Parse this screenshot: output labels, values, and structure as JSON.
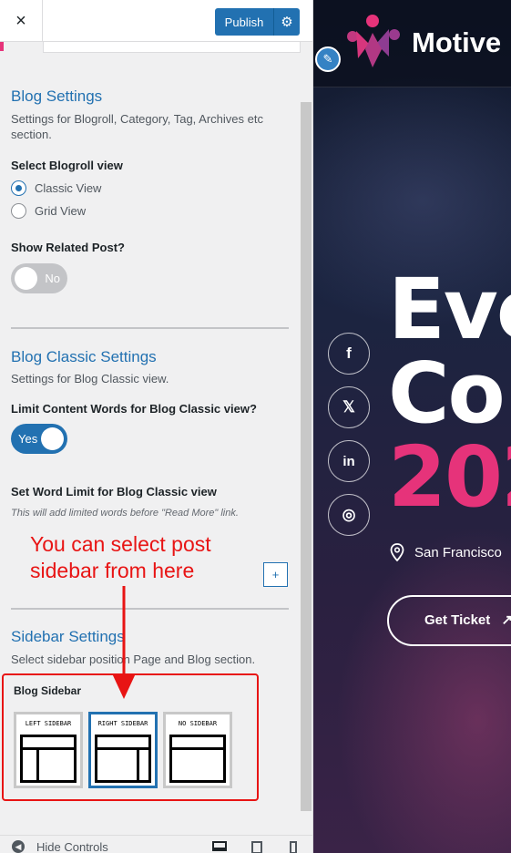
{
  "topbar": {
    "close_icon": "×",
    "publish_label": "Publish",
    "gear_icon": "⚙"
  },
  "blog_settings": {
    "title": "Blog Settings",
    "description": "Settings for Blogroll, Category, Tag, Archives etc section.",
    "blogroll_label": "Select Blogroll view",
    "options": [
      {
        "label": "Classic View",
        "selected": true
      },
      {
        "label": "Grid View",
        "selected": false
      }
    ],
    "related_label": "Show Related Post?",
    "related_toggle": "No"
  },
  "blog_classic": {
    "title": "Blog Classic Settings",
    "description": "Settings for Blog Classic view.",
    "limit_label": "Limit Content Words for Blog Classic view?",
    "limit_toggle": "Yes",
    "word_limit_label": "Set Word Limit for Blog Classic view",
    "word_limit_hint": "This will add limited words before \"Read More\" link.",
    "stepper_plus": "+"
  },
  "annotation": {
    "line1": "You can select post",
    "line2": "sidebar from here"
  },
  "sidebar_settings": {
    "title": "Sidebar Settings",
    "description": "Select sidebar position Page and Blog section.",
    "blog_sidebar_label": "Blog Sidebar",
    "layouts": [
      {
        "caption": "LEFT SIDEBAR",
        "selected": false
      },
      {
        "caption": "RIGHT SIDEBAR",
        "selected": true
      },
      {
        "caption": "NO SIDEBAR",
        "selected": false
      }
    ]
  },
  "bottombar": {
    "hide_controls": "Hide Controls"
  },
  "preview": {
    "logo_text": "Motive",
    "hero_line1": "Eve",
    "hero_line2": "Co",
    "hero_line3": "202",
    "location": "San Francisco",
    "ticket_label": "Get Ticket",
    "social": [
      "f",
      "𝕏",
      "in",
      "◎"
    ],
    "colors": {
      "accent": "#e6337a",
      "wp_blue": "#2271b1",
      "annotation_red": "#e81414"
    }
  }
}
